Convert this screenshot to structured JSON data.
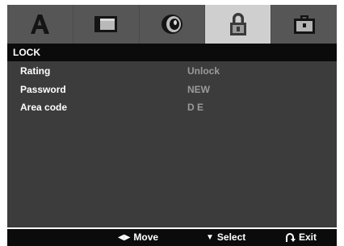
{
  "tabs": [
    {
      "icon": "language-a-icon",
      "active": false
    },
    {
      "icon": "display-screen-icon",
      "active": false
    },
    {
      "icon": "audio-speaker-icon",
      "active": false
    },
    {
      "icon": "lock-icon",
      "active": true
    },
    {
      "icon": "others-briefcase-icon",
      "active": false
    }
  ],
  "section": {
    "title": "LOCK"
  },
  "settings": [
    {
      "label": "Rating",
      "value": "Unlock"
    },
    {
      "label": "Password",
      "value": "NEW"
    },
    {
      "label": "Area code",
      "value": "D E"
    }
  ],
  "help": {
    "move_glyph": "◀▶",
    "move_label": "Move",
    "select_glyph": "▼",
    "select_label": "Select",
    "exit_label": "Exit"
  },
  "colors": {
    "tab_bar": "#565656",
    "tab_active": "#cfcfcf",
    "panel_bg": "#3c3c3c",
    "header_bg": "#0b0b0b",
    "label_text": "#ffffff",
    "value_text": "#9a9a9a"
  }
}
